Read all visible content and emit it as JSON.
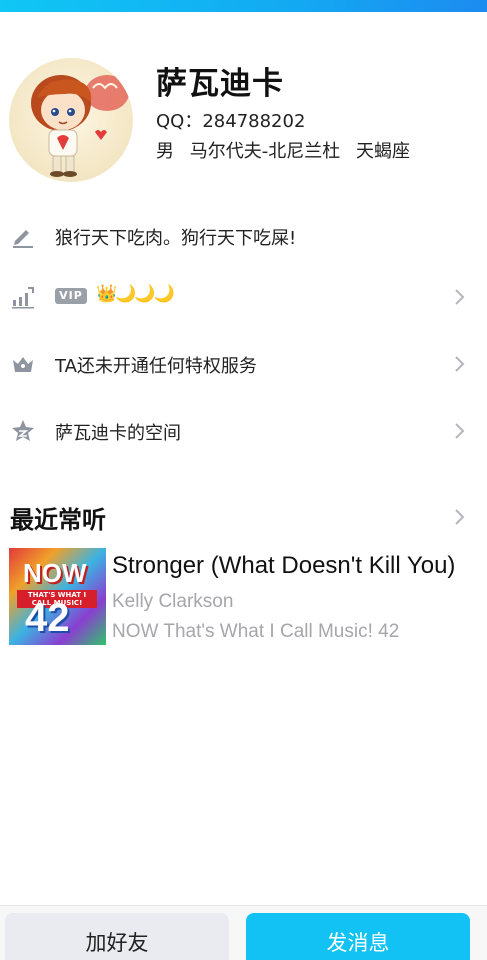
{
  "profile": {
    "name": "萨瓦迪卡",
    "qq_label": "QQ：",
    "qq_number": "284788202",
    "gender": "男",
    "location": "马尔代夫-北尼兰杜",
    "zodiac": "天蝎座"
  },
  "rows": [
    {
      "icon": "pencil-icon",
      "text": "狼行天下吃肉。狗行天下吃屎!"
    },
    {
      "icon": "level-chart-icon",
      "badge": "VIP",
      "level_icons": [
        "👑",
        "🌙",
        "🌙",
        "🌙"
      ]
    },
    {
      "icon": "privilege-crown-icon",
      "text": "TA还未开通任何特权服务"
    },
    {
      "icon": "qzone-star-icon",
      "text": "萨瓦迪卡的空间"
    }
  ],
  "recent": {
    "title": "最近常听",
    "song": {
      "title": "Stronger (What Doesn't Kill You)",
      "artist": "Kelly Clarkson",
      "album": "NOW That's What I Call Music! 42",
      "cover_text_now": "NOW",
      "cover_text_sub": "THAT'S WHAT I CALL MUSIC!",
      "cover_text_num": "42"
    }
  },
  "actions": {
    "add_friend": "加好友",
    "send_message": "发消息"
  },
  "colors": {
    "accent": "#12c2f4",
    "secondary_button": "#e9ebf0",
    "muted_text": "#a6a6ab",
    "icon_gray": "#8e95a0"
  }
}
